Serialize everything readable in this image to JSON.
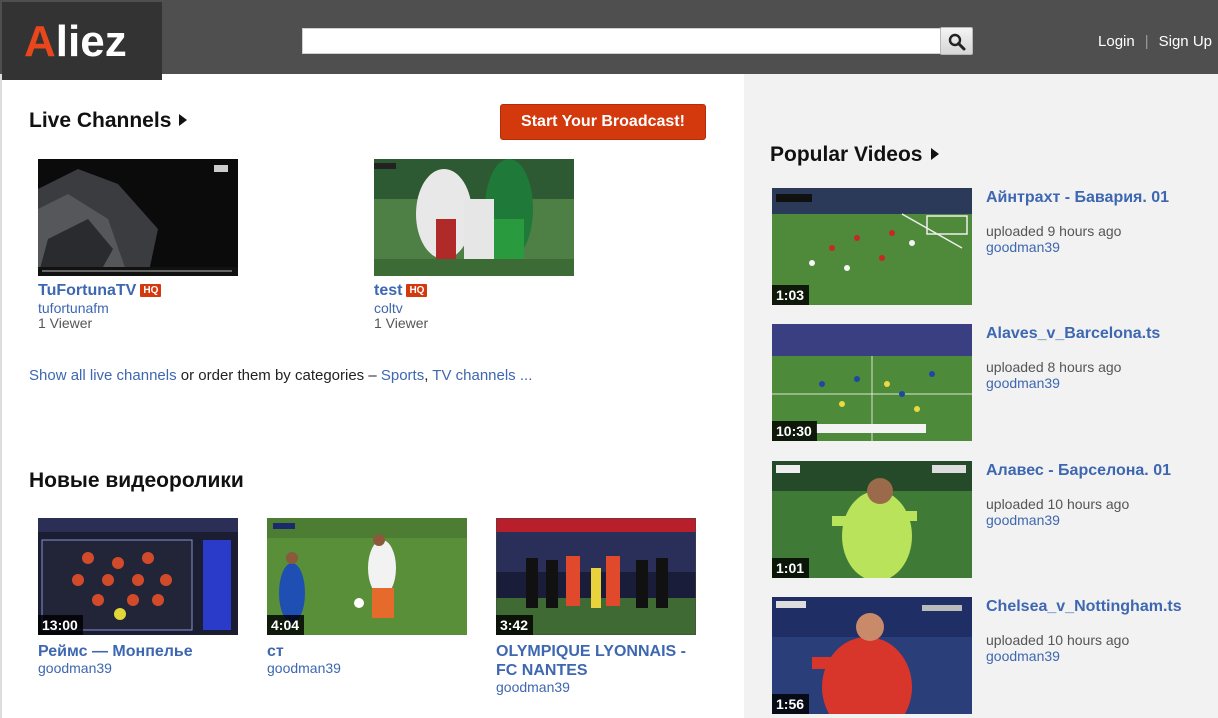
{
  "header": {
    "logo_first": "A",
    "logo_rest": "liez",
    "search_placeholder": "",
    "login": "Login",
    "separator": "|",
    "signup": "Sign Up"
  },
  "live": {
    "title": "Live Channels",
    "broadcast_button": "Start Your Broadcast!",
    "channels": [
      {
        "title": "TuFortunaTV",
        "badge": "HQ",
        "user": "tufortunafm",
        "viewers": "1 Viewer"
      },
      {
        "title": "test",
        "badge": "HQ",
        "user": "coltv",
        "viewers": "1 Viewer"
      }
    ],
    "show_all": "Show all live channels",
    "or_order": " or order them by categories – ",
    "cat_sports": "Sports",
    "comma": ", ",
    "cat_tv": "TV channels",
    "more": " ..."
  },
  "new_videos": {
    "title": "Новые видеоролики",
    "items": [
      {
        "title": "Реймс — Монпелье",
        "user": "goodman39",
        "duration": "13:00"
      },
      {
        "title": "ст",
        "user": "goodman39",
        "duration": "4:04"
      },
      {
        "title": "OLYMPIQUE LYONNAIS - FC NANTES",
        "user": "goodman39",
        "duration": "3:42"
      }
    ]
  },
  "popular": {
    "title": "Popular Videos",
    "items": [
      {
        "title": "Айнтрахт - Бавария. 01",
        "uploaded": "uploaded 9 hours ago",
        "user": "goodman39",
        "duration": "1:03"
      },
      {
        "title": "Alaves_v_Barcelona.ts",
        "uploaded": "uploaded 8 hours ago",
        "user": "goodman39",
        "duration": "10:30"
      },
      {
        "title": "Алавес - Барселона. 01",
        "uploaded": "uploaded 10 hours ago",
        "user": "goodman39",
        "duration": "1:01"
      },
      {
        "title": "Chelsea_v_Nottingham.ts",
        "uploaded": "uploaded 10 hours ago",
        "user": "goodman39",
        "duration": "1:56"
      }
    ]
  },
  "colors": {
    "header_bg": "#4f4f4f",
    "accent": "#d4380d",
    "link": "#3e67b1"
  }
}
